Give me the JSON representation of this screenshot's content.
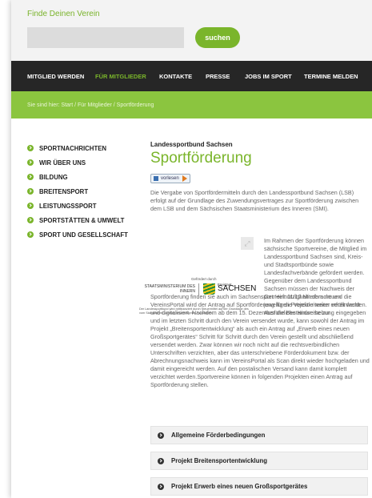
{
  "header": {
    "site_title": "Finde Deinen Verein",
    "search_placeholder": "",
    "search_button": "suchen"
  },
  "nav": {
    "items": [
      "MITGLIED WERDEN",
      "FÜR MITGLIEDER",
      "KONTAKTE",
      "PRESSE",
      "JOBS IM SPORT",
      "TERMINE MELDEN"
    ],
    "active": "FÜR MITGLIEDER"
  },
  "breadcrumb": {
    "prefix": "Sie sind hier:",
    "items": [
      "Start",
      "Für Mitglieder",
      "Sportförderung"
    ],
    "text": "Sie sind hier:  Start / Für Mitglieder / Sportförderung"
  },
  "sidebar": {
    "items": [
      {
        "label": "SPORTNACHRICHTEN"
      },
      {
        "label": "WIR ÜBER UNS"
      },
      {
        "label": "BILDUNG"
      },
      {
        "label": "BREITENSPORT"
      },
      {
        "label": "LEISTUNGSSPORT"
      },
      {
        "label": "SPORTSTÄTTEN & UMWELT"
      },
      {
        "label": "SPORT UND GESELLSCHAFT"
      }
    ]
  },
  "main": {
    "org": "Landessportbund Sachsen",
    "title": "Sportförderung",
    "player_label": "vorlesen",
    "intro": "Die Vergabe von Sportfördermitteln durch den Landessportbund Sachsen (LSB) erfolgt auf der Grundlage des Zuwendungsvertrages zur Sportförderung zwischen dem LSB und dem Sächsischen Staatsministerium des Inneren (SMI).",
    "figure": {
      "funded_by": "Gefördert durch",
      "ministry": "STAATSMINISTERIUM DES INNERN",
      "state_small": "Freistaat",
      "state_big": "SACHSEN",
      "caption": "Der Landessportbund wird mitfinanziert durch Steuermittel auf der Grundlage des vom Sächsischen Landtag beschlossenen Haushaltes."
    },
    "side_text": "Im Rahmen der Sportförderung können sächsische Sportvereine, die Mitglied im Landessportbund Sachsen sind, Kreis- und Stadtsportbünde sowie Landesfachverbände gefördert werden. Gegenüber dem Landessportbund Sachsen müssen der Nachweis der Gemeinnützigkeit erbracht und die jeweiligen Projektkriterien erfüllt werden. Ausführliche Hinweise zur",
    "body_text": "Sportförderung finden sie auch im Sachsensport Heft 11/12.Mit dem neuen VereinsPortal wird der Antrag auf Sportförderung für die Vereine weiter vereinfacht und digitalisiert. Nachdem ab dem 15. Dezember die Bestandserhebung eingegeben und im letzten Schritt durch den Verein versendet wurde, kann sowohl der Antrag im Projekt „Breitensportentwicklung“ als auch ein Antrag auf „Erwerb eines neuen Großsportgerätes“ Schritt für Schritt durch den Verein gestellt und abschließend versendet werden. Zwar können wir noch nicht auf die rechtsverbindlichen Unterschriften verzichten, aber das unterschriebene Förderdokument bzw. der Abrechnungsnachweis kann im VereinsPortal als Scan direkt wieder hochgeladen und damit eingereicht werden. Auf den postalischen Versand kann damit komplett verzichtet werden.Sportvereine können in folgenden Projekten einen Antrag auf Sportförderung stellen."
  },
  "accordion": {
    "items": [
      {
        "label": "Allgemeine Förderbedingungen"
      },
      {
        "label": "Projekt Breitensportentwicklung"
      },
      {
        "label": "Projekt Erwerb eines neuen Großsportgerätes"
      }
    ]
  },
  "colors": {
    "accent": "#7ab52b",
    "nav_bg": "#262626",
    "breadcrumb_bg": "#8bc53f"
  },
  "icons": [
    "chevron-right-icon",
    "expand-icon",
    "speaker-icon",
    "play-icon"
  ]
}
